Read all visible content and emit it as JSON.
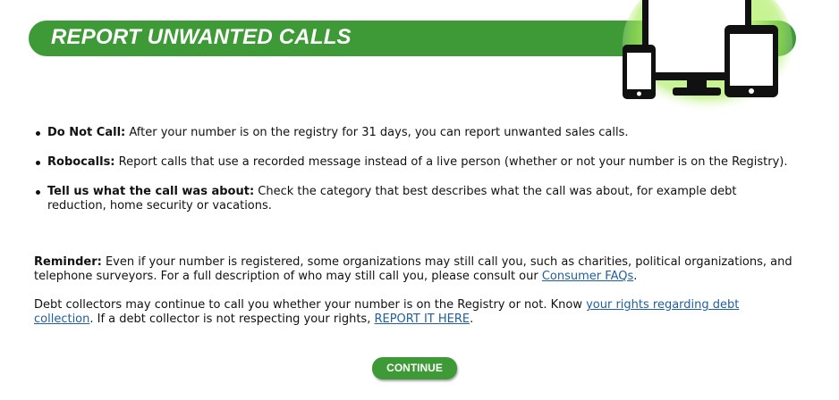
{
  "banner": {
    "title": "REPORT UNWANTED CALLS",
    "image_icon": "devices-icon"
  },
  "bullets": [
    {
      "label": "Do Not Call:",
      "text": " After your number is on the registry for 31 days, you can report unwanted sales calls."
    },
    {
      "label": "Robocalls:",
      "text": " Report calls that use a recorded message instead of a live person (whether or not your number is on the Registry)."
    },
    {
      "label": "Tell us what the call was about:",
      "text": " Check the category that best describes what the call was about, for example debt reduction, home security or vacations."
    }
  ],
  "reminder": {
    "label": "Reminder:",
    "text": " Even if your number is registered, some organizations may still call you, such as charities, political organizations, and telephone surveyors. For a full description of who may still call you, please consult our ",
    "link": "Consumer FAQs",
    "end": "."
  },
  "debt": {
    "text1": "Debt collectors may continue to call you whether your number is on the Registry or not. Know ",
    "link1": "your rights regarding debt collection",
    "text2": ". If a debt collector is not respecting your rights, ",
    "link2": "REPORT IT HERE",
    "end": "."
  },
  "continue_label": "CONTINUE",
  "colors": {
    "brand_green": "#3d9a36",
    "link": "#1f5f9e",
    "glow": "#b9f27a"
  }
}
